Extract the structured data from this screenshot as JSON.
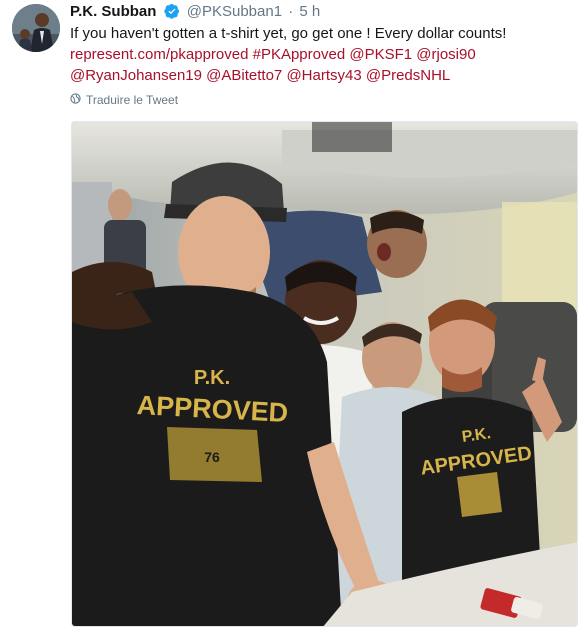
{
  "tweet": {
    "author_name": "P.K. Subban",
    "handle": "@PKSubban1",
    "separator": "·",
    "time": "5 h",
    "text_line": "If you haven't gotten a t-shirt yet, go get one ! Every dollar counts!",
    "links": [
      "represent.com/pkapproved",
      "#PKApproved",
      "@PKSF1",
      "@rjosi90",
      "@RyanJohansen19",
      "@ABitetto7",
      "@Hartsy43",
      "@PredsNHL"
    ],
    "translate_label": "Traduire le Tweet",
    "shirt_text_line1": "P.K.",
    "shirt_text_line2": "APPROVED",
    "shirt_number": "76"
  },
  "colors": {
    "link": "#a8102a",
    "verified": "#1da1f2",
    "secondary_text": "#657786",
    "primary_text": "#14171a"
  },
  "icons": {
    "verified": "verified-badge-icon",
    "translate": "globe-icon"
  }
}
